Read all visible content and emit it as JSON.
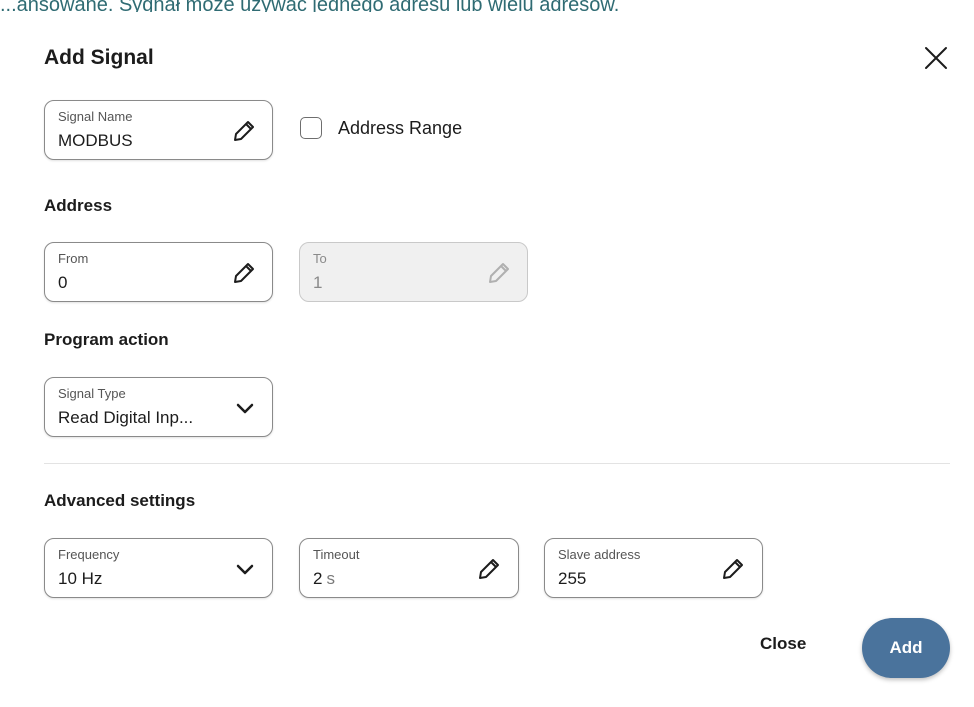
{
  "backdrop": {
    "text": "...ansowane. Sygnał może używać jednego adresu lub wielu adresów."
  },
  "dialog": {
    "title": "Add Signal",
    "close_icon": "close-icon"
  },
  "signal_name": {
    "label": "Signal Name",
    "value": "MODBUS",
    "icon": "pencil-icon"
  },
  "address_range": {
    "label": "Address Range",
    "checked": false
  },
  "address": {
    "heading": "Address",
    "from": {
      "label": "From",
      "value": "0",
      "icon": "pencil-icon"
    },
    "to": {
      "label": "To",
      "value": "1",
      "icon": "pencil-icon",
      "disabled": true
    }
  },
  "program_action": {
    "heading": "Program action",
    "signal_type": {
      "label": "Signal Type",
      "value": "Read Digital Inp...",
      "icon": "chevron-down-icon"
    }
  },
  "advanced": {
    "heading": "Advanced settings",
    "frequency": {
      "label": "Frequency",
      "value": "10 Hz",
      "icon": "chevron-down-icon"
    },
    "timeout": {
      "label": "Timeout",
      "value": "2",
      "unit": "s",
      "icon": "pencil-icon"
    },
    "slave_address": {
      "label": "Slave address",
      "value": "255",
      "icon": "pencil-icon"
    }
  },
  "actions": {
    "close_label": "Close",
    "add_label": "Add"
  },
  "colors": {
    "primary_button": "#4a739c",
    "border": "#8a8a8a",
    "disabled_bg": "#f0f0f0"
  }
}
